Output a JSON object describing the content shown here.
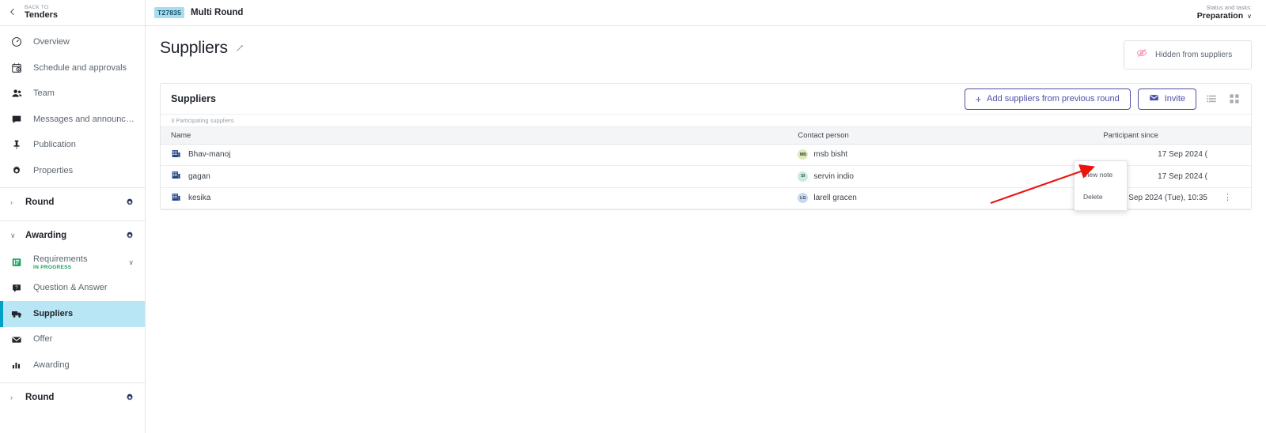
{
  "sidebar": {
    "back": {
      "small": "BACK TO",
      "main": "Tenders"
    },
    "items": [
      {
        "label": "Overview",
        "icon": "gauge-icon"
      },
      {
        "label": "Schedule and approvals",
        "icon": "calendar-clock-icon"
      },
      {
        "label": "Team",
        "icon": "people-icon"
      },
      {
        "label": "Messages and announcem...",
        "icon": "chat-icon"
      },
      {
        "label": "Publication",
        "icon": "pin-icon"
      },
      {
        "label": "Properties",
        "icon": "gear-icon"
      }
    ],
    "group_round_top": {
      "label": "Round",
      "chevron": "›"
    },
    "group_awarding": {
      "label": "Awarding",
      "chevron": "∨"
    },
    "awarding_items": [
      {
        "label": "Requirements",
        "status": "IN PROGRESS",
        "icon": "requirements-icon",
        "chevron": "∨"
      },
      {
        "label": "Question & Answer",
        "icon": "question-answer-icon"
      },
      {
        "label": "Suppliers",
        "icon": "truck-icon",
        "active": true
      },
      {
        "label": "Offer",
        "icon": "envelope-icon"
      },
      {
        "label": "Awarding",
        "icon": "bar-chart-icon"
      }
    ],
    "group_round_bottom": {
      "label": "Round",
      "chevron": "›"
    }
  },
  "topbar": {
    "tender_id": "T27835",
    "tender_name": "Multi Round",
    "status_label": "Status and tasks:",
    "status_value": "Preparation",
    "status_chevron": "∨"
  },
  "page": {
    "title": "Suppliers",
    "edit_icon": "pencil-icon",
    "hidden_chip": {
      "label": "Hidden from suppliers",
      "icon": "eye-off-icon",
      "color": "#f48fb1"
    }
  },
  "card": {
    "title": "Suppliers",
    "add_button": "Add suppliers from previous round",
    "add_button_plus": "+",
    "invite_button": "Invite",
    "invite_icon": "envelope-icon",
    "list_view_icon": "list-view-icon",
    "grid_view_icon": "grid-view-icon",
    "count_text": "3  Participating suppliers",
    "columns": [
      "Name",
      "Contact person",
      "Participant since"
    ],
    "rows": [
      {
        "name": "Bhav-manoj",
        "name_icon": "company-icon",
        "contact": "msb bisht",
        "initials": "MB",
        "avatar_color": "#ddeab4",
        "since": "17 Sep 2024 (",
        "kebab": "⋮"
      },
      {
        "name": "gagan",
        "name_icon": "company-icon",
        "contact": "servin indio",
        "initials": "SI",
        "avatar_color": "#c8ecd9",
        "since": "17 Sep 2024 (",
        "kebab": "⋮"
      },
      {
        "name": "kesika",
        "name_icon": "company-icon",
        "contact": "larell gracen",
        "initials": "LG",
        "avatar_color": "#c5d9f3",
        "since": "17 Sep 2024 (Tue), 10:35",
        "kebab": "⋮"
      }
    ]
  },
  "context_menu": {
    "items": [
      "View note",
      "Delete"
    ]
  },
  "annotation": {
    "arrow_color": "#e8150f"
  }
}
